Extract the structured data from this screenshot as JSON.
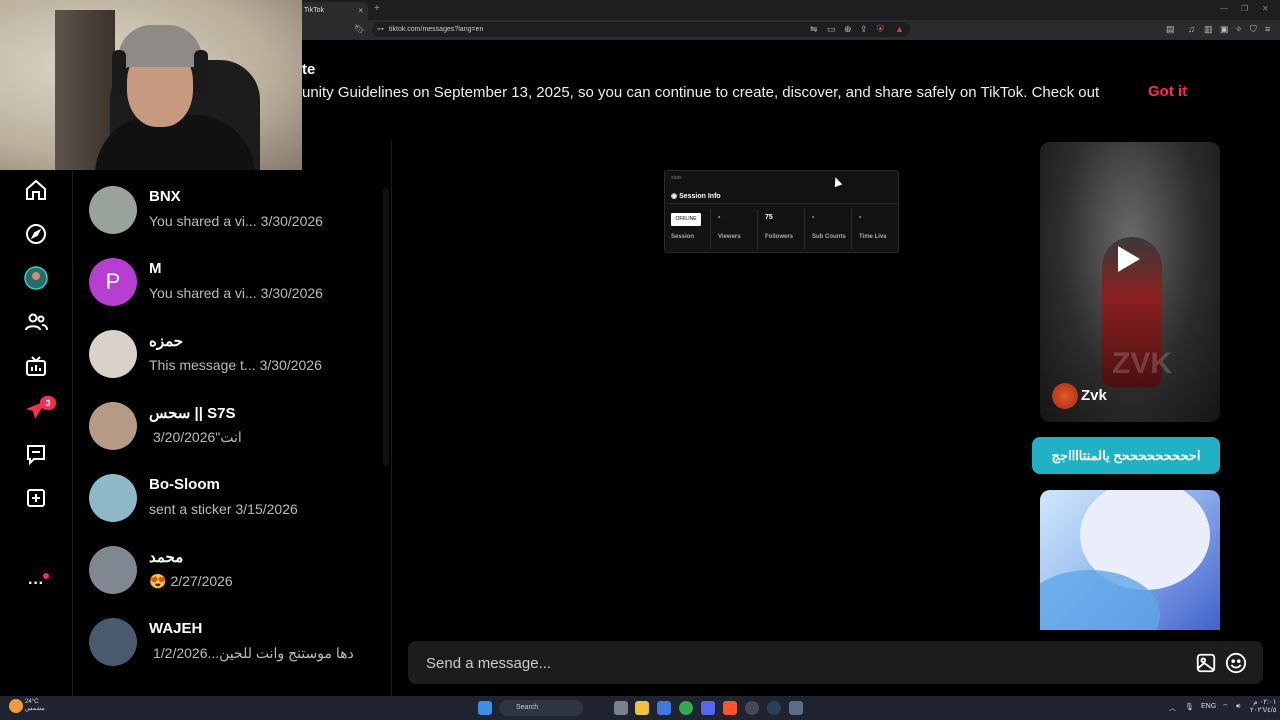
{
  "browser": {
    "tab_title": "TikTok",
    "tab_close": "×",
    "new_tab": "+",
    "url": "tiktok.com/messages?lang=en"
  },
  "banner": {
    "title_fragment": "te",
    "text": "unity Guidelines on September 13, 2025, so you can continue to create, discover, and share safely on TikTok. Check out",
    "got_it": "Got it"
  },
  "nav": {
    "inbox_badge": "3",
    "more": "···"
  },
  "conversations": [
    {
      "name": "BNX",
      "preview": "You shared a vi...",
      "date": "3/30/2026",
      "avatar_color": "#9aa39a"
    },
    {
      "name": "M",
      "preview": "You shared a vi...",
      "date": "3/30/2026",
      "avatar_color": "#b63fd1",
      "initial": "P"
    },
    {
      "name": "حمزه",
      "preview": "This message t...",
      "date": "3/30/2026",
      "avatar_color": "#d8d2c8"
    },
    {
      "name": "سحس || S7S",
      "preview": "انت\"",
      "date": "3/20/2026",
      "avatar_color": "#b69a86"
    },
    {
      "name": "Bo-Sloom",
      "preview": "sent a sticker",
      "date": "3/15/2026",
      "avatar_color": "#8fb8c8"
    },
    {
      "name": "محمد",
      "preview": "😍",
      "date": "2/27/2026",
      "avatar_color": "#7f8790"
    },
    {
      "name": "WAJEH",
      "preview": "دها موستنج وانت للحين...",
      "date": "1/2/2026",
      "avatar_color": "#4a5a6e"
    }
  ],
  "stats_widget": {
    "label": "stats",
    "header": "Session Info",
    "status": "OFFLINE",
    "columns": [
      {
        "value": "",
        "key": "Session"
      },
      {
        "value": "-",
        "key": "Viewers"
      },
      {
        "value": "75",
        "key": "Followers"
      },
      {
        "value": "-",
        "key": "Sub Counts"
      },
      {
        "value": "-",
        "key": "Time Live"
      }
    ]
  },
  "video_card": {
    "author": "Zvk",
    "watermark": "ZVK"
  },
  "message_bubble": "احححححححححح يالمنتااااجج",
  "composer": {
    "placeholder": "Send a message..."
  },
  "taskbar": {
    "weather_temp": "24°C",
    "weather_desc": "مشمس",
    "search": "Search",
    "lang": "ENG",
    "time": "٠٢:٠١ م",
    "date": "٢٠٢٦/٤/٥"
  }
}
